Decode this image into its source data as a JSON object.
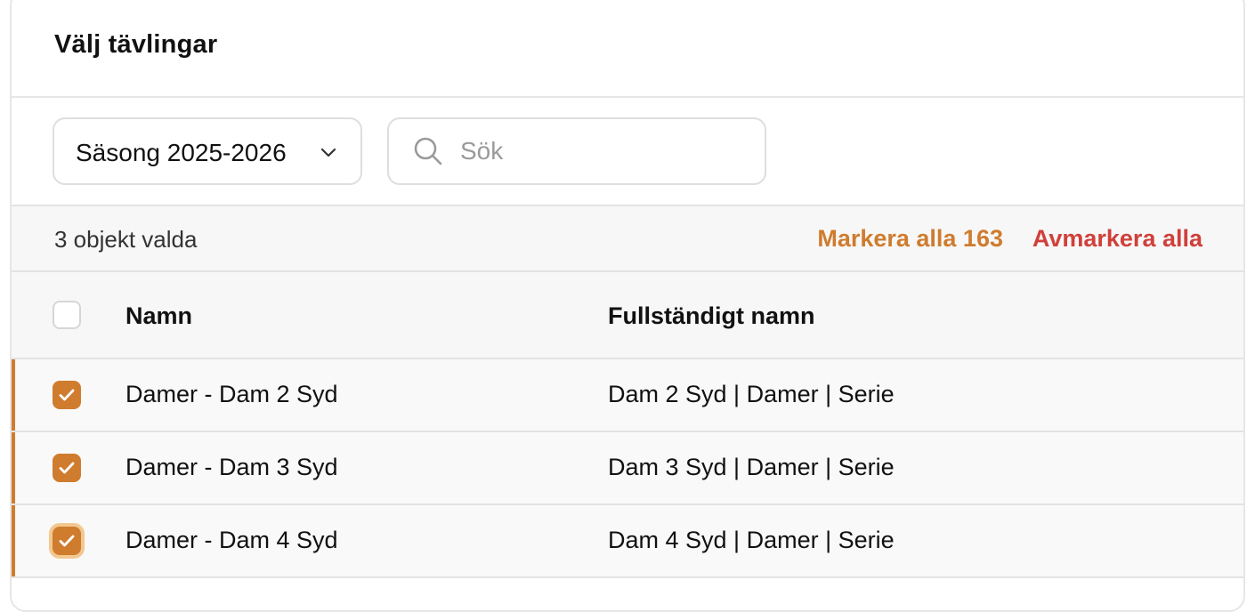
{
  "dialog": {
    "title": "Välj tävlingar"
  },
  "filters": {
    "season_label": "Säsong 2025-2026",
    "search_placeholder": "Sök",
    "search_value": ""
  },
  "selection": {
    "count_text": "3 objekt valda",
    "select_all_label": "Markera alla 163",
    "deselect_all_label": "Avmarkera alla",
    "select_all_color": "#cf7c2e",
    "deselect_all_color": "#d0403a"
  },
  "table": {
    "columns": [
      "Namn",
      "Fullständigt namn"
    ],
    "header_checked": false,
    "rows": [
      {
        "name": "Damer - Dam 2 Syd",
        "full_name": "Dam 2 Syd | Damer | Serie",
        "checked": true
      },
      {
        "name": "Damer - Dam 3 Syd",
        "full_name": "Dam 3 Syd | Damer | Serie",
        "checked": true
      },
      {
        "name": "Damer - Dam 4 Syd",
        "full_name": "Dam 4 Syd | Damer | Serie",
        "checked": true
      }
    ]
  },
  "icons": {
    "select_chevron": "chevron-down-icon",
    "search": "search-icon",
    "checkbox_check": "check-icon"
  },
  "colors": {
    "accent": "#cf7c2e",
    "danger": "#d0403a"
  }
}
